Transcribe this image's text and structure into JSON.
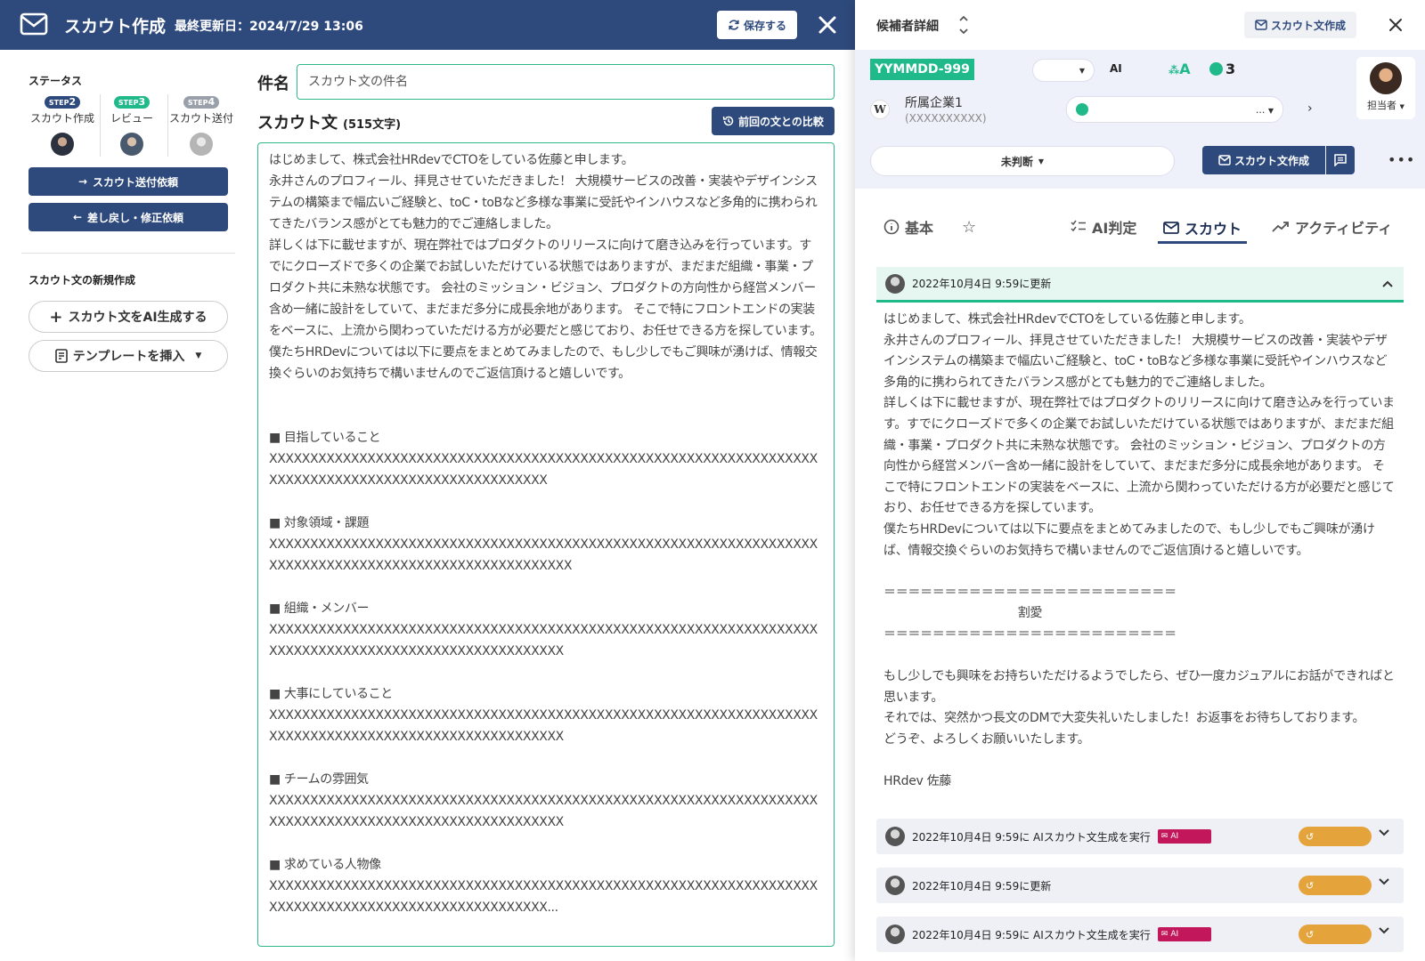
{
  "topbar": {
    "title": "スカウト作成",
    "updated": "最終更新日：2024/7/29 13:06",
    "save_label": "保存する"
  },
  "sidebar": {
    "status_label": "ステータス",
    "steps": [
      {
        "badge": "STEP",
        "num": "2",
        "name": "スカウト作成",
        "color": "#2e4a7d"
      },
      {
        "badge": "STEP",
        "num": "3",
        "name": "レビュー",
        "color": "#1fb98a"
      },
      {
        "badge": "STEP",
        "num": "4",
        "name": "スカウト送付",
        "color": "#9aa0aa"
      }
    ],
    "send_request_label": "スカウト送付依頼",
    "return_label": "差し戻し・修正依頼",
    "new_label": "スカウト文の新規作成",
    "ai_generate_label": "スカウト文をAI生成する",
    "template_label": "テンプレートを挿入"
  },
  "editor": {
    "subject_label": "件名",
    "subject_placeholder": "スカウト文の件名",
    "body_label": "スカウト文",
    "char_count": "(515文字)",
    "compare_label": "前回の文との比較",
    "body": "はじめまして、株式会社HRdevでCTOをしている佐藤と申します。\n永井さんのプロフィール、拝見させていただきました！ 大規模サービスの改善・実装やデザインシステムの構築まで幅広いご経験と、toC・toBなど多様な事業に受託やインハウスなど多角的に携わられてきたバランス感がとても魅力的でご連絡しました。\n詳しくは下に載せますが、現在弊社ではプロダクトのリリースに向けて磨き込みを行っています。すでにクローズドで多くの企業でお試しいただけている状態ではありますが、まだまだ組織・事業・プロダクト共に未熟な状態です。 会社のミッション・ビジョン、プロダクトの方向性から経営メンバー含め一緒に設計をしていて、まだまだ多分に成長余地があります。 そこで特にフロントエンドの実装をベースに、上流から関わっていただける方が必要だと感じており、お任せできる方を探しています。\n僕たちHRDevについては以下に要点をまとめてみましたので、もし少しでもご興味が湧けば、情報交換ぐらいのお気持ちで構いませんのでご返信頂けると嬉しいです。\n\n\n■ 目指していること\nXXXXXXXXXXXXXXXXXXXXXXXXXXXXXXXXXXXXXXXXXXXXXXXXXXXXXXXXXXXXXXXXXXXXXXXXXXXXXXXXXXXXXXXXXXXXXXXXXXXXX\n\n■ 対象領域・課題\nXXXXXXXXXXXXXXXXXXXXXXXXXXXXXXXXXXXXXXXXXXXXXXXXXXXXXXXXXXXXXXXXXXXXXXXXXXXXXXXXXXXXXXXXXXXXXXXXXXXXXXXX\n\n■ 組織・メンバー\nXXXXXXXXXXXXXXXXXXXXXXXXXXXXXXXXXXXXXXXXXXXXXXXXXXXXXXXXXXXXXXXXXXXXXXXXXXXXXXXXXXXXXXXXXXXXXXXXXXXXXXX\n\n■ 大事にしていること\nXXXXXXXXXXXXXXXXXXXXXXXXXXXXXXXXXXXXXXXXXXXXXXXXXXXXXXXXXXXXXXXXXXXXXXXXXXXXXXXXXXXXXXXXXXXXXXXXXXXXXXX\n\n■ チームの雰囲気\nXXXXXXXXXXXXXXXXXXXXXXXXXXXXXXXXXXXXXXXXXXXXXXXXXXXXXXXXXXXXXXXXXXXXXXXXXXXXXXXXXXXXXXXXXXXXXXXXXXXXXXX\n\n■ 求めている人物像\nXXXXXXXXXXXXXXXXXXXXXXXXXXXXXXXXXXXXXXXXXXXXXXXXXXXXXXXXXXXXXXXXXXXXXXXXXXXXXXXXXXXXXXXXXXXXXXXXXXXXX..."
  },
  "detail": {
    "header_title": "候補者詳細",
    "scout_create_label": "スカウト文作成",
    "candidate_id": "YYMMDD-999",
    "ai_label": "AI",
    "rank": "A",
    "message_count": "3",
    "assignee_label": "担当者",
    "company_name": "所属企業1",
    "company_sub": "(XXXXXXXXXX)",
    "media_select": "...",
    "judgement": "未判断",
    "scout_button_label": "スカウト文作成",
    "tabs": [
      {
        "label": "基本"
      },
      {
        "label": "AI判定"
      },
      {
        "label": "スカウト"
      },
      {
        "label": "アクティビティ"
      }
    ],
    "history": [
      {
        "text": "2022年10月4日 9:59に更新"
      },
      {
        "text": "2022年10月4日 9:59に AIスカウト文生成を実行",
        "badge": "AI"
      },
      {
        "text": "2022年10月4日 9:59に更新"
      },
      {
        "text": "2022年10月4日 9:59に AIスカウト文生成を実行",
        "badge": "AI"
      }
    ],
    "scout_body": "はじめまして、株式会社HRdevでCTOをしている佐藤と申します。\n永井さんのプロフィール、拝見させていただきました！ 大規模サービスの改善・実装やデザインシステムの構築まで幅広いご経験と、toC・toBなど多様な事業に受託やインハウスなど多角的に携わられてきたバランス感がとても魅力的でご連絡しました。\n詳しくは下に載せますが、現在弊社ではプロダクトのリリースに向けて磨き込みを行っています。すでにクローズドで多くの企業でお試しいただけている状態ではありますが、まだまだ組織・事業・プロダクト共に未熟な状態です。 会社のミッション・ビジョン、プロダクトの方向性から経営メンバー含め一緒に設計をしていて、まだまだ多分に成長余地があります。 そこで特にフロントエンドの実装をベースに、上流から関わっていただける方が必要だと感じており、お任せできる方を探しています。\n僕たちHRDevについては以下に要点をまとめてみましたので、もし少しでもご興味が湧けば、情報交換ぐらいのお気持ちで構いませんのでご返信頂けると嬉しいです。\n\n＝＝＝＝＝＝＝＝＝＝＝＝＝＝＝＝＝＝＝＝＝＝＝＝\n　　　　　　　　　　　割愛\n＝＝＝＝＝＝＝＝＝＝＝＝＝＝＝＝＝＝＝＝＝＝＝＝\n\nもし少しでも興味をお持ちいただけるようでしたら、ぜひ一度カジュアルにお話ができればと思います。\nそれでは、突然かつ長文のDMで大変失礼いたしました！お返事をお待ちしております。\nどうぞ、よろしくお願いいたします。\n\nHRdev 佐藤"
  },
  "colors": {
    "navy": "#2e4a7d",
    "green": "#1fb98a",
    "ai_badge": "#c2185b",
    "history_pill": "#e5a43b"
  }
}
